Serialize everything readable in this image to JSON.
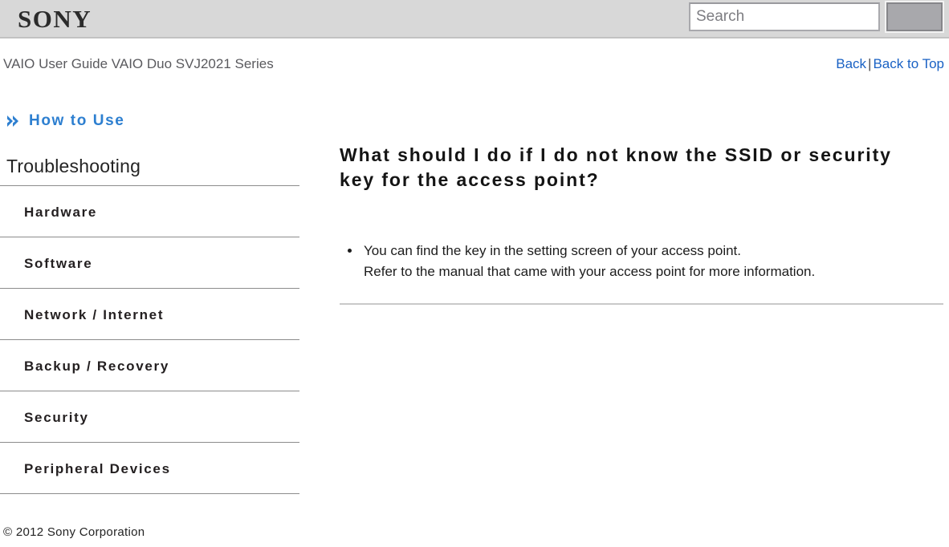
{
  "header": {
    "logo_text": "SONY",
    "search": {
      "placeholder": "Search",
      "value": "",
      "button_label": ""
    }
  },
  "breadcrumb": {
    "title": "VAIO User Guide VAIO Duo SVJ2021 Series",
    "back_label": "Back",
    "separator": "|",
    "back_to_top_label": "Back to Top"
  },
  "sidebar": {
    "how_to_use_label": "How to Use",
    "how_to_use_icon": "double-chevron-right-icon",
    "section_title": "Troubleshooting",
    "items": [
      {
        "label": "Hardware"
      },
      {
        "label": "Software"
      },
      {
        "label": "Network / Internet"
      },
      {
        "label": "Backup / Recovery"
      },
      {
        "label": "Security"
      },
      {
        "label": "Peripheral Devices"
      }
    ]
  },
  "main": {
    "heading": "What should I do if I do not know the SSID or security key for the access point?",
    "bullets": [
      "You can find the key in the setting screen of your access point.\nRefer to the manual that came with your access point for more information."
    ]
  },
  "footer": {
    "copyright": "© 2012 Sony Corporation"
  },
  "colors": {
    "header_bg": "#d8d8d8",
    "link_blue": "#1961c4",
    "accent_blue": "#2d7fd0",
    "divider": "#8c8c8c",
    "text": "#231f20"
  }
}
